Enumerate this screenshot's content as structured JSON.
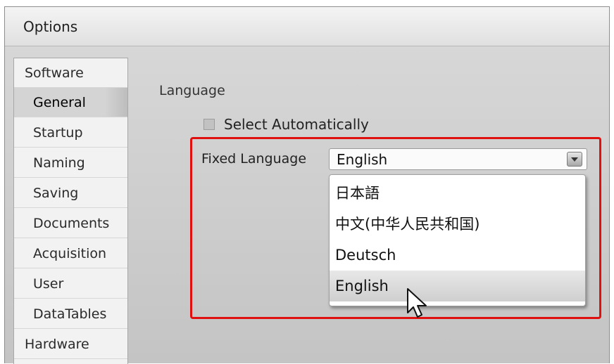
{
  "window": {
    "title": "Options"
  },
  "nav": {
    "items": [
      {
        "label": "Software",
        "level": "top",
        "selected": false
      },
      {
        "label": "General",
        "level": "sub",
        "selected": true
      },
      {
        "label": "Startup",
        "level": "sub",
        "selected": false
      },
      {
        "label": "Naming",
        "level": "sub",
        "selected": false
      },
      {
        "label": "Saving",
        "level": "sub",
        "selected": false
      },
      {
        "label": "Documents",
        "level": "sub",
        "selected": false
      },
      {
        "label": "Acquisition",
        "level": "sub",
        "selected": false
      },
      {
        "label": "User",
        "level": "sub",
        "selected": false
      },
      {
        "label": "DataTables",
        "level": "sub",
        "selected": false
      },
      {
        "label": "Hardware",
        "level": "top",
        "selected": false
      }
    ]
  },
  "language": {
    "section_label": "Language",
    "auto_select": {
      "label": "Select Automatically",
      "checked": false
    },
    "fixed_label": "Fixed Language",
    "selected_value": "English",
    "options": [
      "日本語",
      "中文(中华人民共和国)",
      "Deutsch",
      "English"
    ],
    "hovered_option": "English"
  },
  "colors": {
    "highlight_border": "#e01010"
  },
  "icons": {
    "combo_button": "chevron-down-icon",
    "cursor": "mouse-pointer-icon"
  }
}
